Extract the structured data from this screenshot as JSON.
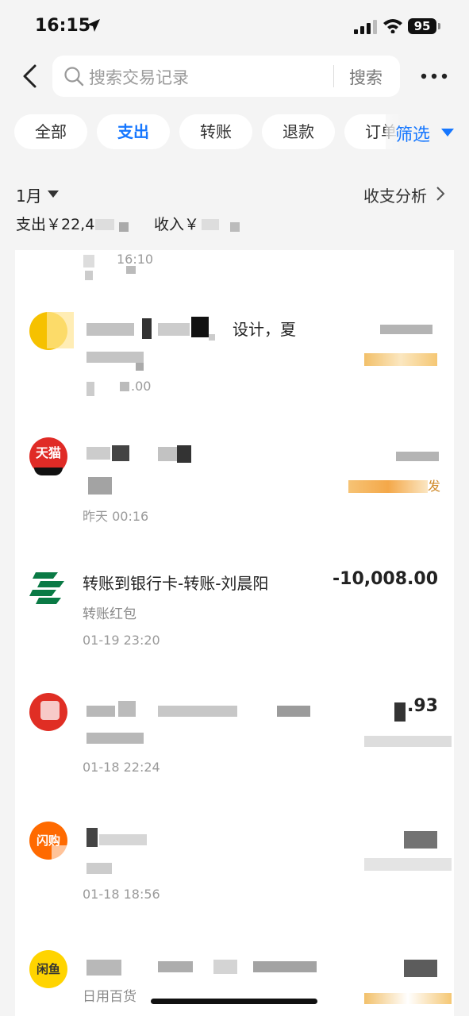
{
  "status_bar": {
    "time": "16:15",
    "battery": "95"
  },
  "header": {
    "search_placeholder": "搜索交易记录",
    "search_button": "搜索"
  },
  "tabs": [
    {
      "label": "全部",
      "active": false
    },
    {
      "label": "支出",
      "active": true
    },
    {
      "label": "转账",
      "active": false
    },
    {
      "label": "退款",
      "active": false
    },
    {
      "label": "订单",
      "active": false
    }
  ],
  "filter_label": "筛选",
  "period": {
    "month": "1月",
    "analysis": "收支分析"
  },
  "summary": {
    "expense_prefix": "支出￥22,4",
    "income_prefix": "收入￥"
  },
  "transactions": [
    {
      "title": "",
      "sub": "",
      "time": "16:10",
      "amount": "",
      "icon": "partial-row"
    },
    {
      "title": "设计，夏",
      "sub": "",
      "time": ".00",
      "amount": "",
      "icon": "merchant-yellow-icon"
    },
    {
      "title": "",
      "sub": "",
      "time": "昨天 00:16",
      "amount": "",
      "icon": "tmall-icon",
      "icon_text": "天猫",
      "tag": "发"
    },
    {
      "title": "转账到银行卡-转账-刘晨阳",
      "sub": "转账红包",
      "time": "01-19 23:20",
      "amount": "-10,008.00",
      "icon": "china-post-bank-icon"
    },
    {
      "title": "",
      "sub": "",
      "time": "01-18 22:24",
      "amount": ".93",
      "icon": "pinduoduo-icon"
    },
    {
      "title": "",
      "sub": "",
      "time": "01-18 18:56",
      "amount": "",
      "icon": "flash-buy-icon",
      "icon_text": "闪购"
    },
    {
      "title": "",
      "sub": "日用百货",
      "time": "",
      "amount": "",
      "icon": "xianyu-icon",
      "icon_text": "闲鱼"
    }
  ],
  "colors": {
    "accent": "#1677ff",
    "background": "#f4f4f4",
    "amount": "#222222"
  }
}
